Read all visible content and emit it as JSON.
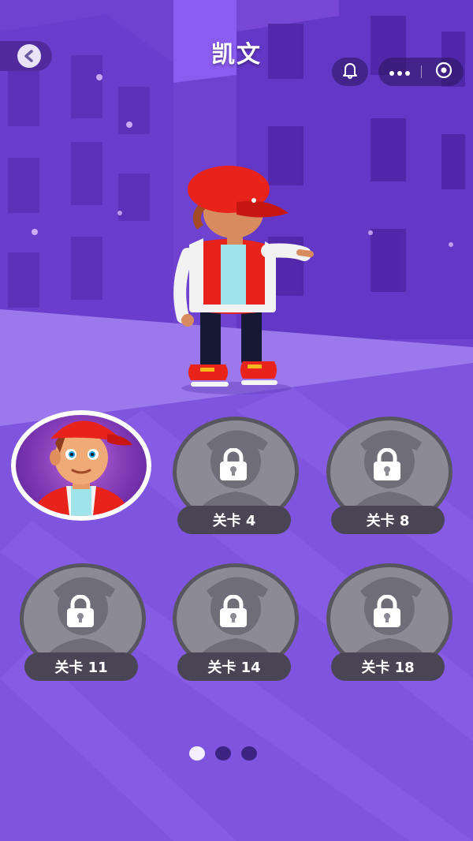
{
  "header": {
    "title": "凯文",
    "back_icon": "chevron-left-icon",
    "bell_icon": "bell-icon",
    "more_icon": "more-dots-icon",
    "eye_icon": "eye-icon"
  },
  "character": {
    "name": "凯文"
  },
  "slots": [
    {
      "state": "unlocked",
      "label": ""
    },
    {
      "state": "locked",
      "label": "关卡 4"
    },
    {
      "state": "locked",
      "label": "关卡 8"
    },
    {
      "state": "locked",
      "label": "关卡 11"
    },
    {
      "state": "locked",
      "label": "关卡 14"
    },
    {
      "state": "locked",
      "label": "关卡 18"
    }
  ],
  "pagination": {
    "pages": 3,
    "current": 1
  },
  "colors": {
    "background": "#7a52d8",
    "floor": "#9c7aee",
    "accent_red": "#e8231b",
    "locked_grey": "#8c8a94",
    "label_bg": "#4a4554"
  }
}
